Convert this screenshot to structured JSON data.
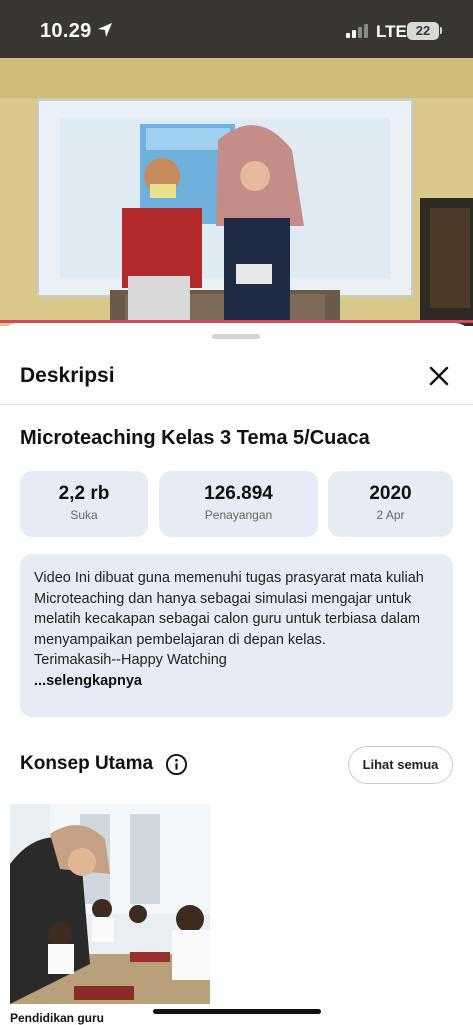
{
  "status_bar": {
    "time": "10.29",
    "network": "LTE",
    "battery": "22"
  },
  "video": {
    "progress_fraction": 1.0,
    "accent_color": "#d6485a"
  },
  "sheet": {
    "title": "Deskripsi",
    "video_title": "Microteaching Kelas 3 Tema 5/Cuaca",
    "stats": [
      {
        "value": "2,2 rb",
        "label": "Suka"
      },
      {
        "value": "126.894",
        "label": "Penayangan"
      },
      {
        "value": "2020",
        "label": "2 Apr"
      }
    ],
    "description": {
      "text": "Video Ini dibuat guna memenuhi tugas prasyarat mata kuliah Microteaching dan hanya sebagai simulasi mengajar untuk melatih kecakapan sebagai calon guru untuk terbiasa dalam menyampaikan pembelajaran di depan kelas.",
      "thanks": "Terimakasih--Happy Watching",
      "more": "...selengkapnya"
    },
    "concepts": {
      "title": "Konsep Utama",
      "see_all": "Lihat semua",
      "items": [
        {
          "label": "Pendidikan guru"
        }
      ]
    }
  },
  "icons": {
    "location": "location-arrow-icon",
    "signal": "cellular-signal-icon",
    "close": "close-icon",
    "info": "info-icon"
  }
}
